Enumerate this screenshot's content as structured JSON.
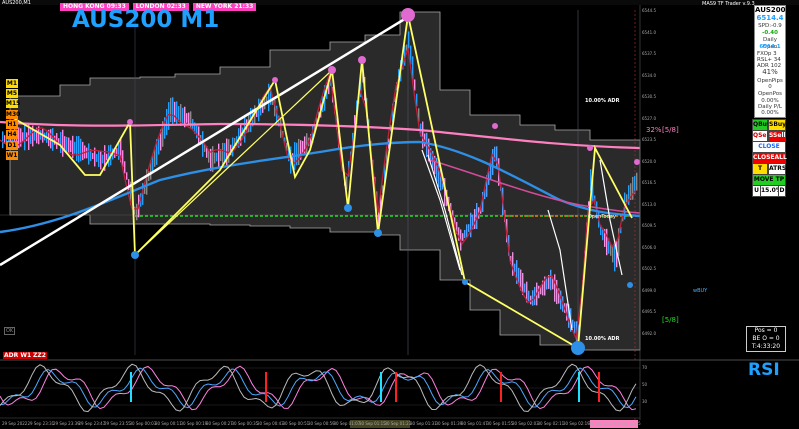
{
  "chart": {
    "symbol_small": "AUS200,M1",
    "title": "AUS200 M1",
    "sessions": [
      {
        "label": "HONG KONG 09:33",
        "color": "#ff3fbf"
      },
      {
        "label": "LONDON 02:33",
        "color": "#ff3fbf"
      },
      {
        "label": "NEW YORK 21:33",
        "color": "#ff3fbf"
      }
    ],
    "top_right_note": "MAS9 TF Trader v.9.3",
    "adr_label_top": "10.00% ADR",
    "adr_label_bottom": "10.00% ADR",
    "pct_label": "32%",
    "bracket_top": "[5/8]",
    "bracket_bottom": "[5/8]",
    "wbuy_label": "wBUY",
    "open_label": "OpenToday",
    "ok_label": "OK",
    "adr_tag": "ADR W1",
    "zz_tag": "ZZ2",
    "rsi_title": "RSI"
  },
  "timeframes": [
    {
      "label": "M1",
      "color": "#ffdd00"
    },
    {
      "label": "M5",
      "color": "#ffdd00"
    },
    {
      "label": "M15",
      "color": "#ffdd00"
    },
    {
      "label": "M30",
      "color": "#ff8c00"
    },
    {
      "label": "H1",
      "color": "#ff8c00"
    },
    {
      "label": "H4",
      "color": "#ff8c00"
    },
    {
      "label": "D1",
      "color": "#ff8c00"
    },
    {
      "label": "W1",
      "color": "#ff8c00"
    }
  ],
  "panel": {
    "symbol": "AUS200",
    "price": "6514.4",
    "spd": "SPD:-0.9",
    "change": "-0.40",
    "daily_open_label": "Daily Open",
    "daily_open": "6514.1",
    "fxop": "FXOp",
    "fxop_val": "3",
    "rsl": "RSL+",
    "rsl_val": "34",
    "adr": "ADR",
    "adr_val": "102",
    "pct": "41%",
    "open_pips_label": "OpenPips",
    "open_pips_val": "0",
    "open_pos_label": "OpenPos",
    "open_pos_val": "0.00%",
    "daily_pl_label": "Daily P/L",
    "daily_pl_val": "0.00%"
  },
  "buttons": {
    "qbuy": "QBuy",
    "sbuy": "SBuy",
    "qsell": "QSell",
    "ssell": "SSell",
    "close": "CLOSE",
    "closeall": "CLOSEALL",
    "tsl": "T SL",
    "atrsl": "ATRSL",
    "move_tp": "MOVE TP",
    "lot_u": "U",
    "lot_pct": "15.0%",
    "lot_d": "D"
  },
  "position_box": {
    "pos": "Pos = 0",
    "be": "BE O = 0",
    "t": "T:4:33:20"
  },
  "x_axis": [
    "29 Sep 2022",
    "29 Sep 23:31",
    "29 Sep 23:39",
    "29 Sep 23:47",
    "29 Sep 23:55",
    "30 Sep 00:03",
    "30 Sep 00:11",
    "30 Sep 00:19",
    "30 Sep 00:27",
    "30 Sep 00:35",
    "30 Sep 00:43",
    "30 Sep 00:51",
    "30 Sep 00:59",
    "30 Sep 01:07",
    "30 Sep 01:15",
    "30 Sep 01:23",
    "30 Sep 01:31",
    "30 Sep 01:39",
    "30 Sep 01:47",
    "30 Sep 01:55",
    "30 Sep 02:03",
    "30 Sep 02:11",
    "30 Sep 02:19",
    "30 Sep 02:27",
    "30 Sep 02:35"
  ],
  "y_axis": [
    "6544.5",
    "6541.0",
    "6537.5",
    "6534.0",
    "6530.5",
    "6527.0",
    "6523.5",
    "6520.0",
    "6516.5",
    "6513.0",
    "6509.5",
    "6506.0",
    "6502.5",
    "6499.0",
    "6495.5",
    "6492.0"
  ],
  "rsi_axis": [
    "70",
    "50",
    "30"
  ]
}
